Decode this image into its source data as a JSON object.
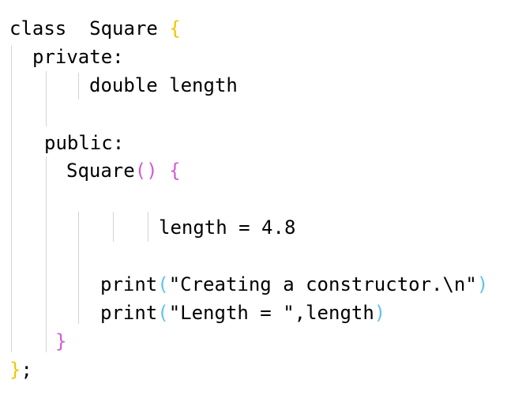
{
  "code": {
    "line_class": {
      "keyword": "class",
      "spacer": "  ",
      "name": "Square",
      "space": " ",
      "open_brace": "{"
    },
    "line_private": {
      "text": "private:"
    },
    "line_double": {
      "text": "double length"
    },
    "line_public": {
      "text": "public:"
    },
    "line_ctor": {
      "name": "Square",
      "open_paren": "(",
      "close_paren": ")",
      "space": " ",
      "open_brace": "{"
    },
    "line_assign": {
      "text": "length = 4.8"
    },
    "line_print1": {
      "fn": "print",
      "open_paren": "(",
      "arg": "\"Creating a constructor.\\n\"",
      "close_paren": ")"
    },
    "line_print2": {
      "fn": "print",
      "open_paren": "(",
      "arg": "\"Length = \",length",
      "close_paren": ")"
    },
    "line_ctor_close": {
      "close_brace": "}"
    },
    "line_class_close": {
      "close_brace": "}",
      "semicolon": ";"
    }
  },
  "colors": {
    "outer_brace": "#f2c500",
    "inner_brace": "#d25ad7",
    "call_paren": "#62c2ee",
    "ctor_paren": "#d25ad7",
    "indent_guide": "#d3d3d3",
    "text": "#000000",
    "background": "#ffffff"
  }
}
